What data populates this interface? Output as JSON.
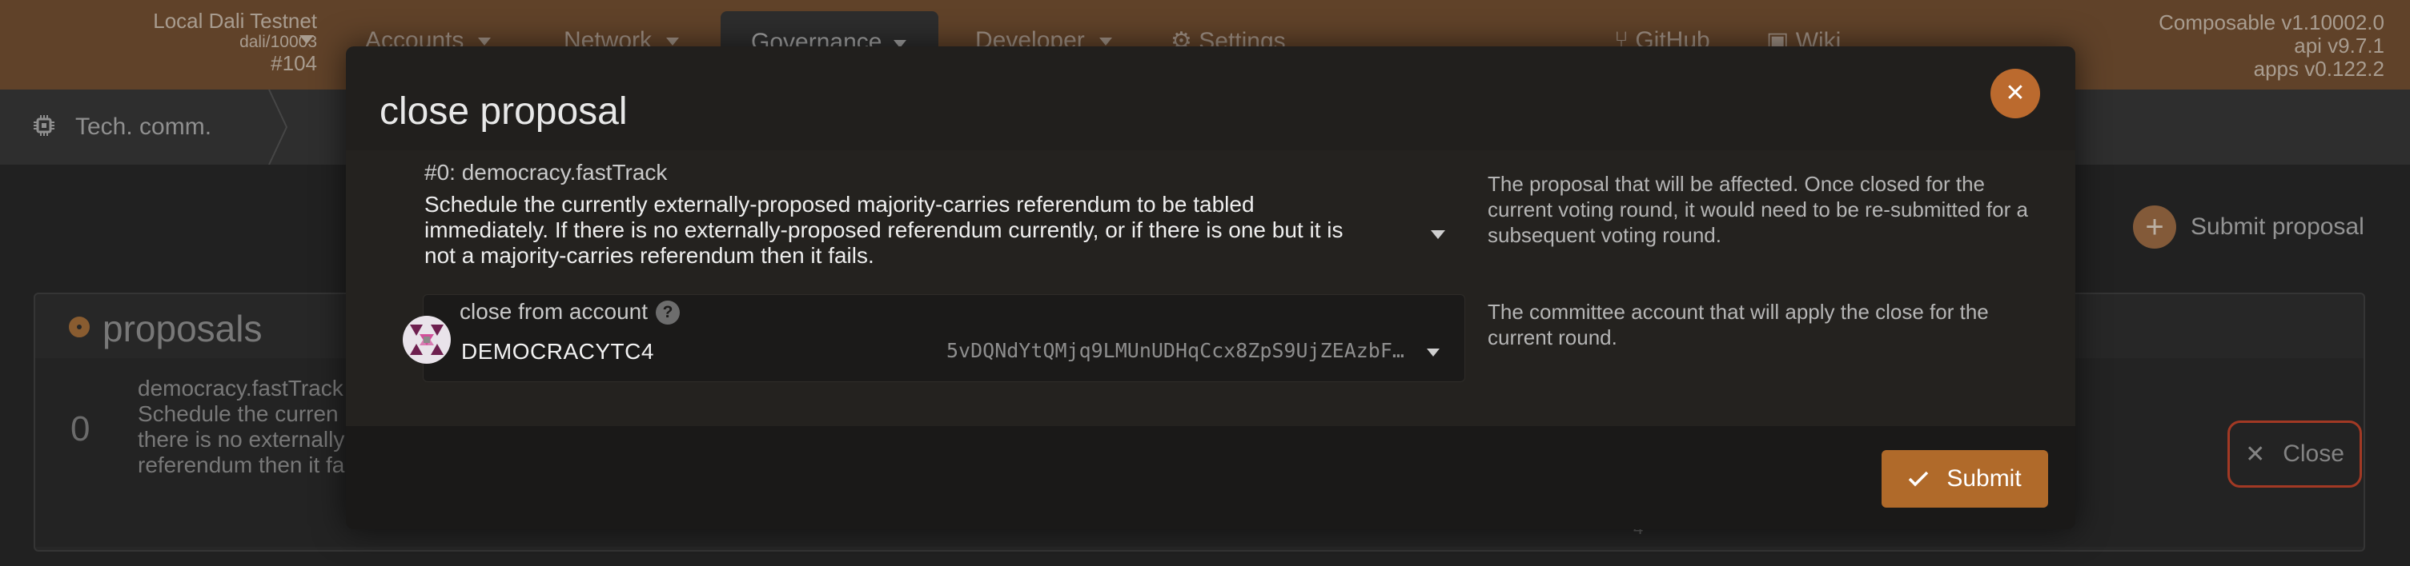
{
  "header": {
    "chain_name": "Local Dali Testnet",
    "chain_id": "dali/10003",
    "block": "#104",
    "nav": {
      "accounts": "Accounts",
      "network": "Network",
      "governance": "Governance",
      "developer": "Developer",
      "settings": "Settings",
      "github": "GitHub",
      "wiki": "Wiki"
    },
    "versions": {
      "node": "Composable v1.10002.0",
      "api": "api v9.7.1",
      "apps": "apps v0.122.2"
    }
  },
  "subnav": {
    "label": "Tech. comm."
  },
  "page": {
    "submit_proposal_label": "Submit proposal",
    "proposals_title": "proposals",
    "row": {
      "index": "0",
      "line1": "democracy.fastTrack",
      "line2": "Schedule the curren",
      "line3": "there is no externally",
      "line4": "referendum then it fa"
    },
    "close_label": "Close",
    "stray_text": "4"
  },
  "modal": {
    "title": "close proposal",
    "proposal": {
      "call": "#0: democracy.fastTrack",
      "description": "Schedule the currently externally-proposed majority-carries referendum to be tabled immediately. If there is no externally-proposed referendum currently, or if there is one but it is not a majority-carries referendum then it fails.",
      "help": "The proposal that will be affected. Once closed for the current voting round, it would need to be re-submitted for a subsequent voting round."
    },
    "account": {
      "label": "close from account",
      "help_glyph": "?",
      "name": "DEMOCRACYTC4",
      "address": "5vDQNdYtQMjq9LMUnUDHqCcx8ZpS9UjZEAzbF…",
      "help": "The committee account that will apply the close for the current round."
    },
    "submit_label": "Submit"
  },
  "colors": {
    "header_bg": "#7c5535",
    "accent": "#b06a2a",
    "close_border": "#d04a2f"
  }
}
